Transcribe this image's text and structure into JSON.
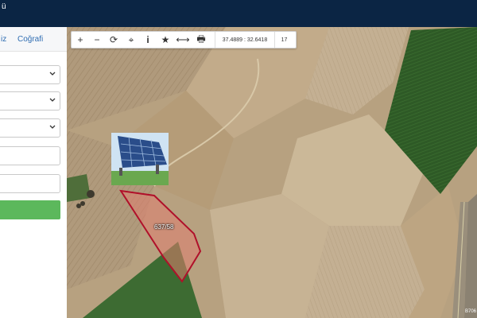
{
  "app": {
    "title": "ü"
  },
  "sidebar": {
    "tabs": [
      {
        "label": "iz"
      },
      {
        "label": "Coğrafi"
      }
    ]
  },
  "map": {
    "toolbar": {
      "tools": [
        {
          "icon": "plus-icon",
          "glyph": "+"
        },
        {
          "icon": "minus-icon",
          "glyph": "−"
        },
        {
          "icon": "refresh-icon",
          "glyph": "⟳"
        },
        {
          "icon": "locate-icon",
          "glyph": "⌖"
        },
        {
          "icon": "info-icon",
          "glyph": "i"
        },
        {
          "icon": "star-icon",
          "glyph": "★"
        },
        {
          "icon": "measure-icon",
          "glyph": "⟷"
        },
        {
          "icon": "print-icon",
          "glyph": "🖶"
        }
      ],
      "coordinates": "37.4889 : 32.6418",
      "zoom_level": "17"
    },
    "parcel_label": "637/58",
    "corner_text": "B706"
  },
  "colors": {
    "header_bg": "#0b2544",
    "tab_text": "#2f6db2",
    "green_button": "#5cb85c",
    "parcel_stroke": "#b0102a",
    "parcel_fill": "#e08070"
  }
}
